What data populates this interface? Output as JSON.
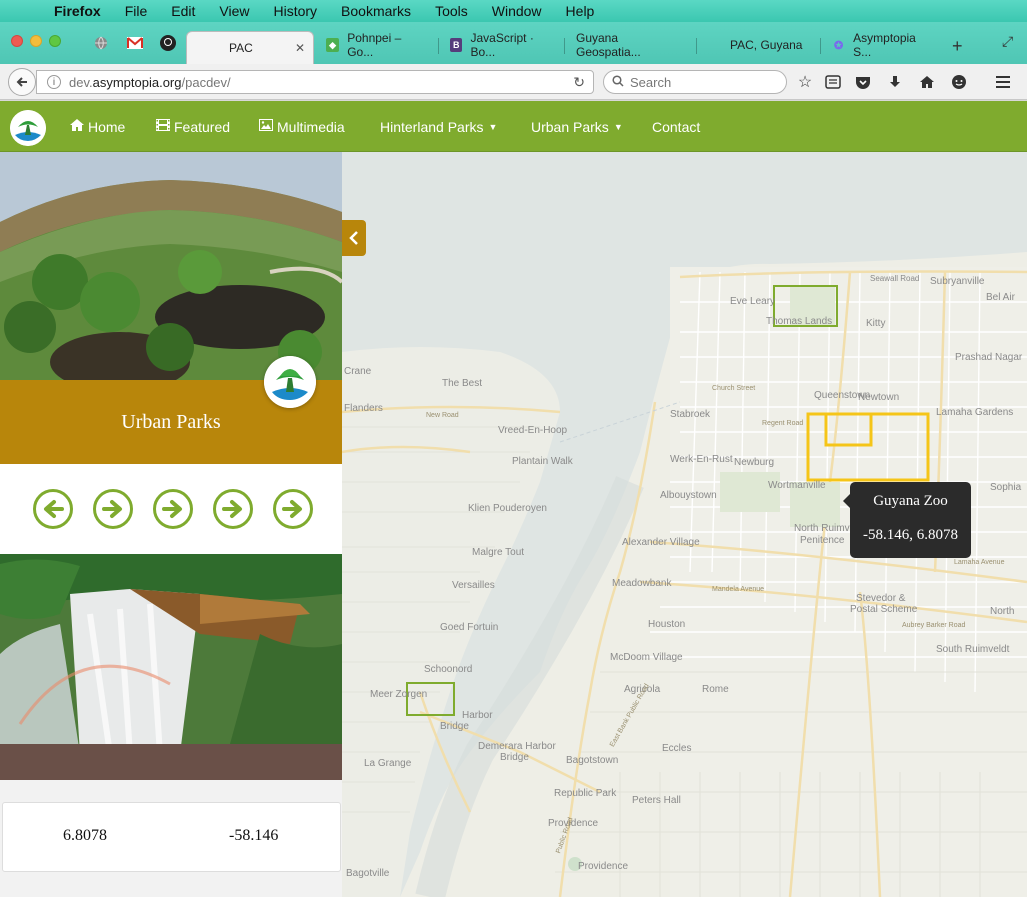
{
  "menubar": {
    "app": "Firefox",
    "items": [
      "File",
      "Edit",
      "View",
      "History",
      "Bookmarks",
      "Tools",
      "Window",
      "Help"
    ]
  },
  "tabs": [
    {
      "label": "PAC",
      "active": true
    },
    {
      "label": "Pohnpei – Go...",
      "active": false
    },
    {
      "label": "JavaScript · Bo...",
      "active": false
    },
    {
      "label": "Guyana Geospatia...",
      "active": false
    },
    {
      "label": "PAC, Guyana",
      "active": false
    },
    {
      "label": "Asymptopia S...",
      "active": false
    }
  ],
  "url": {
    "prefix": "dev.",
    "host": "asymptopia.org",
    "path": "/pacdev/"
  },
  "search": {
    "placeholder": "Search"
  },
  "site_nav": {
    "home": "Home",
    "featured": "Featured",
    "multimedia": "Multimedia",
    "hinterland": "Hinterland Parks",
    "urban": "Urban Parks",
    "contact": "Contact"
  },
  "panel": {
    "banner_title": "Urban Parks",
    "coords": {
      "lat": "6.8078",
      "lon": "-58.146"
    }
  },
  "tooltip": {
    "title": "Guyana Zoo",
    "coords": "-58.146, 6.8078"
  },
  "map_labels": {
    "seawall": "Seawall Road",
    "subryanville": "Subryanville",
    "belair": "Bel Air",
    "eveleary": "Eve Leary",
    "thomaslands": "Thomas Lands",
    "kitty": "Kitty",
    "prashad": "Prashad Nagar",
    "queenstown": "Queenstown",
    "newtown": "Newtown",
    "lamaha": "Lamaha Gardens",
    "stabroek": "Stabroek",
    "newburg": "Newburg",
    "werkenrust": "Werk-En-Rust",
    "wortmanville": "Wortmanville",
    "albouystown": "Albouystown",
    "northruimveldt": "North Ruimveldt",
    "penitence": "Penitence",
    "alexander": "Alexander Village",
    "meadowbank": "Meadowbank",
    "stevedor": "Stevedor &",
    "postal": "Postal Scheme",
    "north": "North",
    "southruimveldt": "South Ruimveldt",
    "houston": "Houston",
    "mcdoom": "McDoom Village",
    "agricola": "Agricola",
    "rome": "Rome",
    "eccles": "Eccles",
    "bagotstown": "Bagotstown",
    "republic": "Republic Park",
    "petershall": "Peters Hall",
    "providence": "Providence",
    "providence2": "Providence",
    "crane": "Crane",
    "thebest": "The Best",
    "flanders": "Flanders",
    "vreed": "Vreed-En-Hoop",
    "plantain": "Plantain Walk",
    "klien": "Klien Pouderoyen",
    "malgre": "Malgre Tout",
    "versailles": "Versailles",
    "goed": "Goed Fortuin",
    "schoonord": "Schoonord",
    "meerzorgen": "Meer Zorgen",
    "harbor": "Harbor",
    "bridge": "Bridge",
    "demerara": "Demerara Harbor",
    "bridge2": "Bridge",
    "lagrange": "La Grange",
    "nbagotville": "Bagotville",
    "sophia": "Sophia",
    "newroad": "New Road",
    "regent": "Regent Road",
    "church": "Church Street",
    "mandela": "Mandela Avenue",
    "aubrey": "Aubrey Barker Road",
    "lamaha_ave": "Lamaha Avenue",
    "eastbank": "East Bank Public Road",
    "publicroad": "Public Road"
  },
  "colors": {
    "nav_green": "#7fab2e",
    "gold": "#b8860b",
    "park_box_green": "#7fab2e",
    "zoo_box_yellow": "#f5c518"
  }
}
